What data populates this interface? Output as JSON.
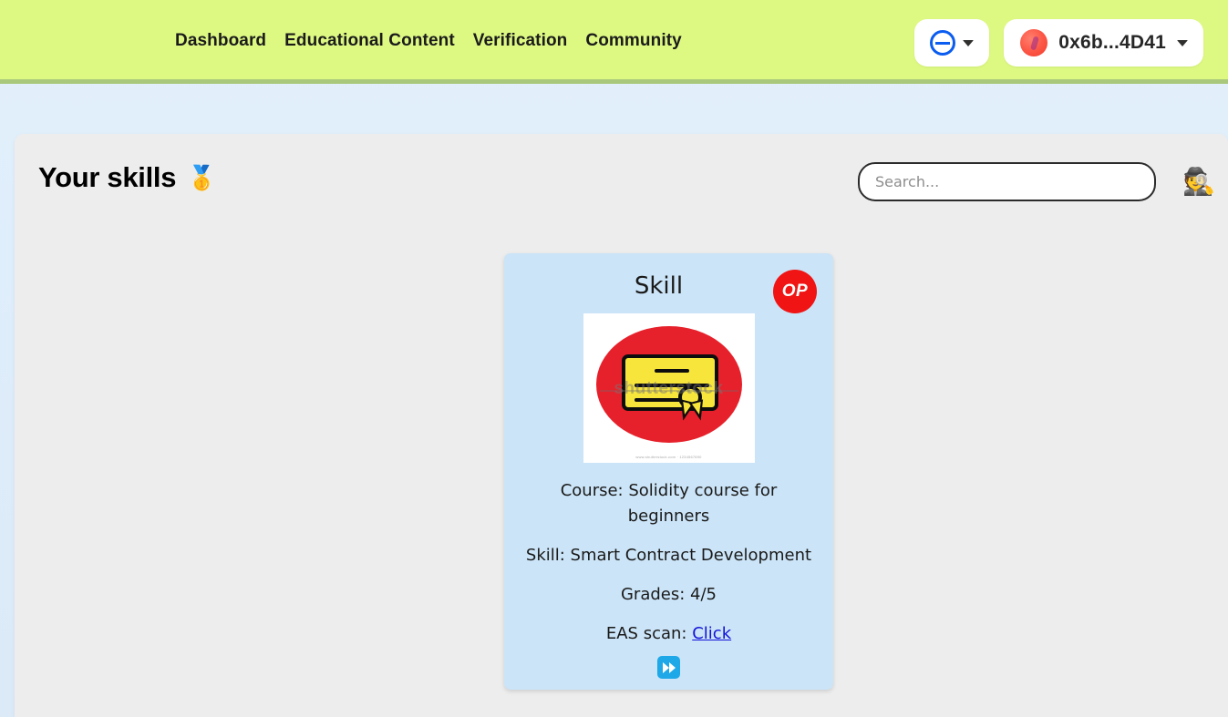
{
  "navbar": {
    "links": [
      {
        "label": "Dashboard"
      },
      {
        "label": "Educational Content"
      },
      {
        "label": "Verification"
      },
      {
        "label": "Community"
      }
    ],
    "network_selector": {
      "icon": "chain-circle-icon",
      "chevron": "chevron-down-icon"
    },
    "wallet": {
      "address": "0x6b...4D41",
      "avatar": "wallet-avatar",
      "chevron": "chevron-down-icon"
    },
    "colors": {
      "background": "#ddf982",
      "border_bottom": "#a9c87c"
    }
  },
  "page": {
    "title": "Your skills",
    "title_emoji": "🥇",
    "background": "#ededed"
  },
  "search": {
    "placeholder": "Search...",
    "value": "",
    "side_emoji": "🕵️"
  },
  "cards": [
    {
      "title": "Skill",
      "badge": "OP",
      "badge_color": "#f01414",
      "image": {
        "type": "certificate-stock-photo",
        "watermark": "shutterstock",
        "footer": "www.shutterstock.com · 1234567890"
      },
      "course": "Course: Solidity course for beginners",
      "skill": "Skill: Smart Contract Development",
      "grades": "Grades: 4/5",
      "eas_label": "EAS scan:",
      "eas_link": "Click",
      "action_icon": "fast-forward-icon",
      "background": "#cbe4f7"
    }
  ]
}
